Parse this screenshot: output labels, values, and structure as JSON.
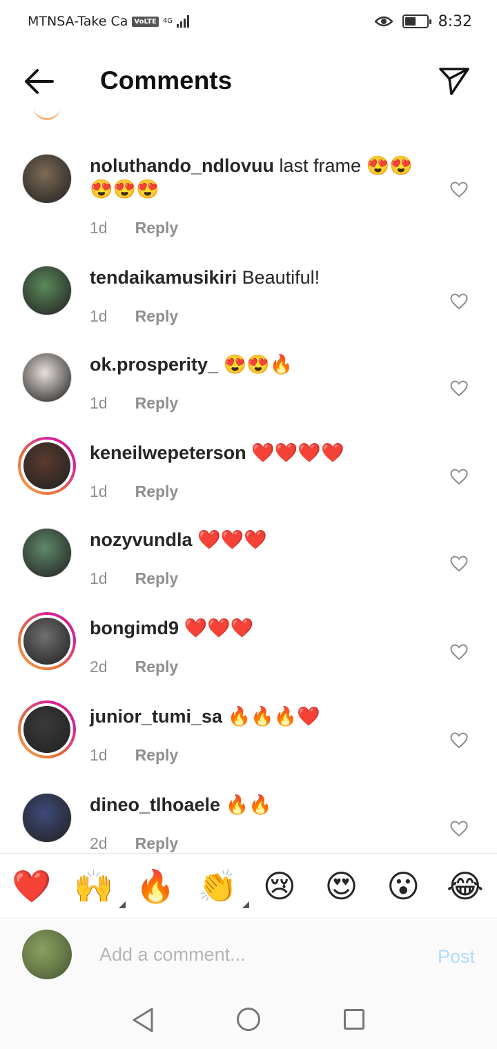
{
  "status_bar": {
    "carrier": "MTNSA-Take Ca",
    "volte": "VoLTE",
    "network": "4G",
    "time": "8:32",
    "battery_level": 0.5
  },
  "header": {
    "title": "Comments"
  },
  "comments": [
    {
      "username": "noluthando_ndlovuu",
      "text": " last frame 😍😍😍😍😍",
      "age": "1d",
      "reply": "Reply",
      "story_ring": false,
      "avatar_color": "#7d6b55"
    },
    {
      "username": "tendaikamusikiri",
      "text": " Beautiful!",
      "age": "1d",
      "reply": "Reply",
      "story_ring": false,
      "avatar_color": "#5a8a5a"
    },
    {
      "username": "ok.prosperity_",
      "text": " 😍😍🔥",
      "age": "1d",
      "reply": "Reply",
      "story_ring": false,
      "avatar_color": "#e9e1dc"
    },
    {
      "username": "keneilwepeterson",
      "text": " ❤️❤️❤️❤️",
      "age": "1d",
      "reply": "Reply",
      "story_ring": true,
      "avatar_color": "#5a3a2e"
    },
    {
      "username": "nozyvundla",
      "text": " ❤️❤️❤️",
      "age": "1d",
      "reply": "Reply",
      "story_ring": false,
      "avatar_color": "#5f8a6a"
    },
    {
      "username": "bongimd9",
      "text": " ❤️❤️❤️",
      "age": "2d",
      "reply": "Reply",
      "story_ring": true,
      "avatar_color": "#6f6f6f"
    },
    {
      "username": "junior_tumi_sa",
      "text": " 🔥🔥🔥❤️",
      "age": "1d",
      "reply": "Reply",
      "story_ring": true,
      "avatar_color": "#3a3a3a"
    },
    {
      "username": "dineo_tlhoaele",
      "text": " 🔥🔥",
      "age": "2d",
      "reply": "Reply",
      "story_ring": false,
      "avatar_color": "#3f4a7a"
    }
  ],
  "emoji_bar": [
    "❤️",
    "🙌",
    "🔥",
    "👏",
    "😢",
    "😍",
    "😮",
    "😂"
  ],
  "input": {
    "placeholder": "Add a comment...",
    "post_label": "Post"
  }
}
